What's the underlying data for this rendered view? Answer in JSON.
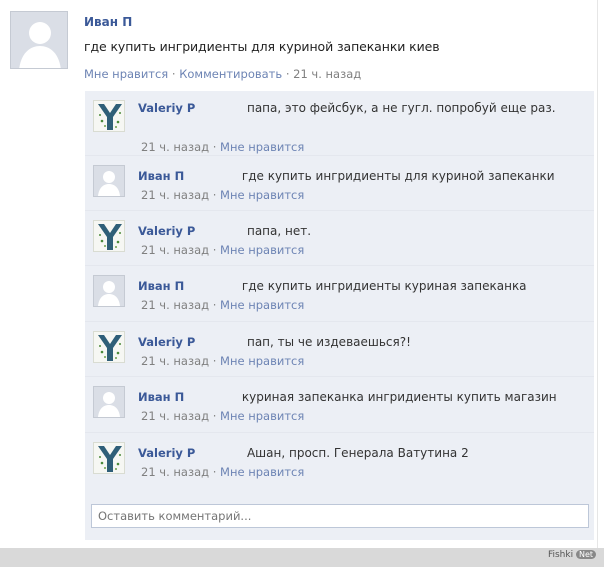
{
  "post": {
    "author": "Иван П",
    "text": "где купить ингридиенты для куриной запеканки киев",
    "like": "Мне нравится",
    "sep1": "·",
    "comment": "Комментировать",
    "sep2": "·",
    "time": "21 ч. назад"
  },
  "comments": [
    {
      "author": "Valeriy P",
      "text": "папа, это фейсбук, а не гугл. попробуй еще раз.",
      "time": "21 ч. назад",
      "sep": "·",
      "like": "Мне нравится"
    },
    {
      "author": "Иван П",
      "text": "где купить ингридиенты для куриной запеканки",
      "time": "21 ч. назад",
      "sep": "·",
      "like": "Мне нравится"
    },
    {
      "author": "Valeriy P",
      "text": "папа, нет.",
      "time": "21 ч. назад",
      "sep": "·",
      "like": "Мне нравится"
    },
    {
      "author": "Иван П",
      "text": "где купить ингридиенты куриная запеканка",
      "time": "21 ч. назад",
      "sep": "·",
      "like": "Мне нравится"
    },
    {
      "author": "Valeriy P",
      "text": "пап, ты че издеваешься?!",
      "time": "21 ч. назад",
      "sep": "·",
      "like": "Мне нравится"
    },
    {
      "author": "Иван П",
      "text": "куриная запеканка ингридиенты купить магазин",
      "time": "21 ч. назад",
      "sep": "·",
      "like": "Мне нравится"
    },
    {
      "author": "Valeriy P",
      "text": "Ашан, просп. Генерала Ватутина 2",
      "time": "21 ч. назад",
      "sep": "·",
      "like": "Мне нравится"
    }
  ],
  "comment_input": {
    "placeholder": "Оставить комментарий..."
  },
  "watermark": {
    "brand": "Fishki",
    "net": "Net"
  }
}
